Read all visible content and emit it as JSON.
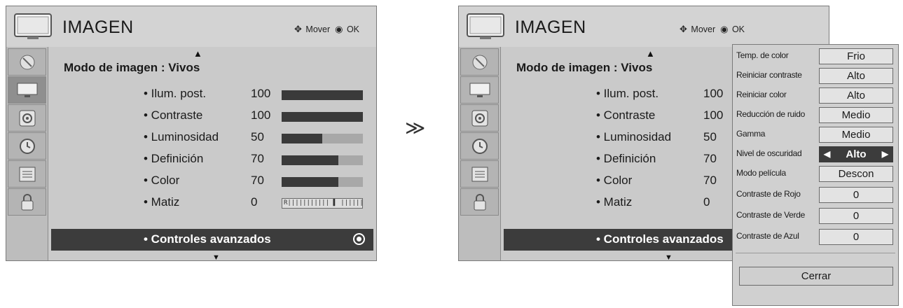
{
  "left_panel": {
    "title": "IMAGEN",
    "hint": "Mover",
    "hint_ok": "OK",
    "mode_label": "Modo de imagen",
    "mode_value": ": Vivos",
    "rows": [
      {
        "label": "• Ilum. post.",
        "value": "100",
        "level": 1.0
      },
      {
        "label": "• Contraste",
        "value": "100",
        "level": 1.0
      },
      {
        "label": "• Luminosidad",
        "value": "50",
        "level": 0.5
      },
      {
        "label": "• Definición",
        "value": "70",
        "level": 0.7
      },
      {
        "label": "• Color",
        "value": "70",
        "level": 0.7
      },
      {
        "label": "• Matiz",
        "value": "0",
        "tint_text": "R|||||||||||  ▌  |||||||||||G"
      }
    ],
    "advanced": "• Controles avanzados"
  },
  "separator": "≫",
  "right_panel": {
    "title": "IMAGEN",
    "hint": "Mover",
    "hint_ok": "OK",
    "mode_label": "Modo de imagen",
    "mode_value": ": Vivos",
    "rows": [
      {
        "label": "• Ilum. post.",
        "value": "100"
      },
      {
        "label": "• Contraste",
        "value": "100"
      },
      {
        "label": "• Luminosidad",
        "value": "50"
      },
      {
        "label": "• Definición",
        "value": "70"
      },
      {
        "label": "• Color",
        "value": "70"
      },
      {
        "label": "• Matiz",
        "value": "0"
      }
    ],
    "advanced": "• Controles avanzados"
  },
  "popup": {
    "items": [
      {
        "label": "Temp. de color",
        "value": "Frio"
      },
      {
        "label": "Reiniciar contraste",
        "value": "Alto"
      },
      {
        "label": "Reiniciar color",
        "value": "Alto"
      },
      {
        "label": "Reducción de ruido",
        "value": "Medio"
      },
      {
        "label": "Gamma",
        "value": "Medio"
      },
      {
        "label": "Nivel de oscuridad",
        "value": "Alto",
        "selected": true
      },
      {
        "label": "Modo película",
        "value": "Descon"
      },
      {
        "label": "Contraste de Rojo",
        "value": "0"
      },
      {
        "label": "Contraste de Verde",
        "value": "0"
      },
      {
        "label": "Contraste de Azul",
        "value": "0"
      }
    ],
    "close": "Cerrar"
  },
  "colors": {
    "selected_bg": "#3c3c3c",
    "bar_fill": "#3a3a3a",
    "bar_track": "#a8a8a8"
  }
}
